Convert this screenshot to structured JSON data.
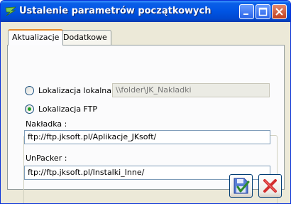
{
  "window": {
    "title": "Ustalenie parametrów początkowych"
  },
  "tabs": [
    {
      "label": "Aktualizacje",
      "active": true
    },
    {
      "label": "Dodatkowe",
      "active": false
    }
  ],
  "location": {
    "local_label": "Lokalizacja lokalna",
    "local_selected": false,
    "local_path": "\\\\folder\\JK_Nakladki",
    "ftp_label": "Lokalizacja FTP",
    "ftp_selected": true
  },
  "fields": {
    "nakladka_label": "Nakładka :",
    "nakladka_value": "ftp://ftp.jksoft.pl/Aplikacje_JKsoft/",
    "unpacker_label": "UnPacker :",
    "unpacker_value": "ftp://ftp.jksoft.pl/Instalki_Inne/"
  },
  "colors": {
    "titlebar": "#0054e3",
    "ok_check": "#2e8b2e",
    "cancel_x": "#d32f2f"
  },
  "icons": {
    "app": "app-logo-icon",
    "ok": "save-ok-icon",
    "cancel": "cancel-x-icon"
  }
}
